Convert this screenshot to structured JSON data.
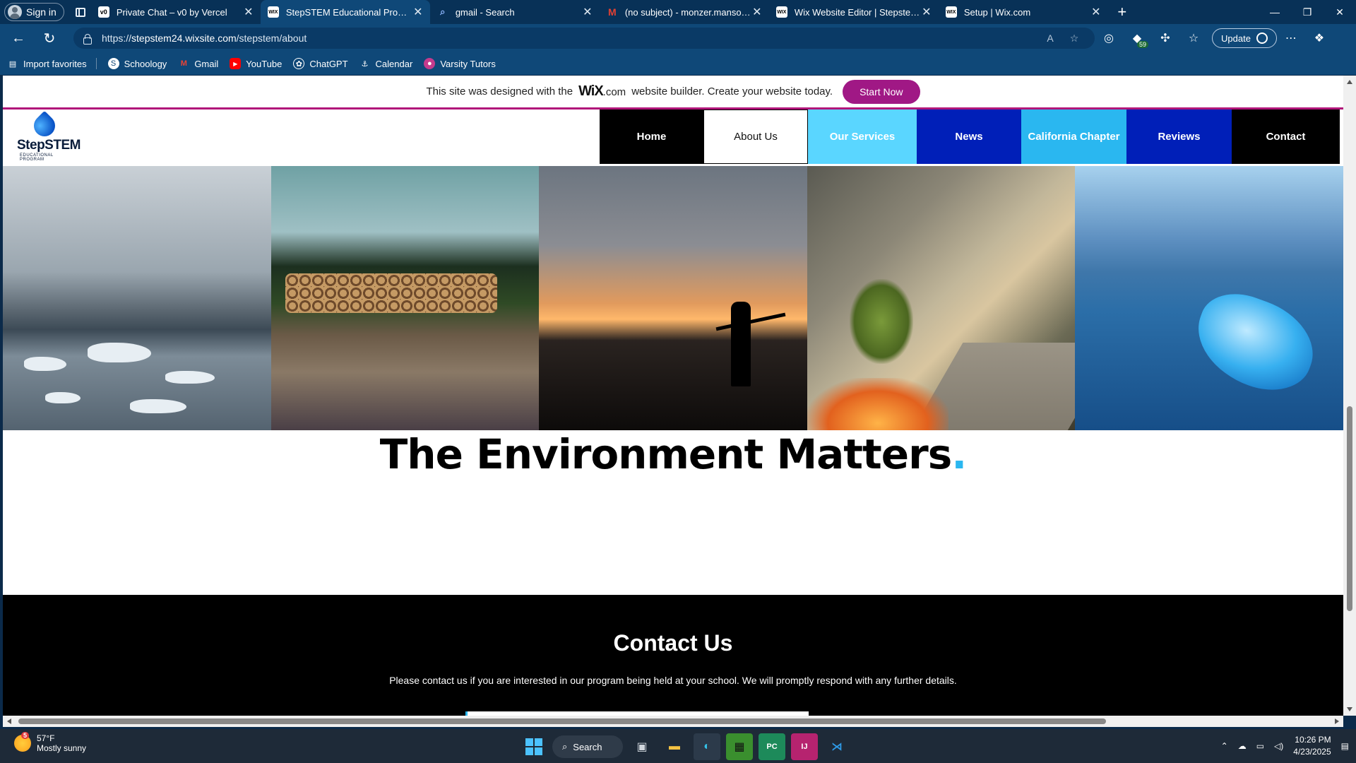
{
  "browser": {
    "signin_label": "Sign in",
    "tabs": [
      {
        "title": "Private Chat – v0 by Vercel",
        "favicon": "v0"
      },
      {
        "title": "StepSTEM Educational Program",
        "favicon": "WIX",
        "active": true
      },
      {
        "title": "gmail - Search",
        "favicon": "search"
      },
      {
        "title": "(no subject) - monzer.mansour@",
        "favicon": "M"
      },
      {
        "title": "Wix Website Editor | Stepstem Ed",
        "favicon": "WIX"
      },
      {
        "title": "Setup | Wix.com",
        "favicon": "WIX"
      }
    ],
    "url_prefix": "https://",
    "url_host": "stepstem24.wixsite.com",
    "url_path": "/stepstem/about",
    "extension_badge": "59",
    "update_label": "Update",
    "favorites": [
      {
        "label": "Import favorites",
        "icon": "import-icon"
      },
      {
        "label": "Schoology",
        "icon": "schoology-icon"
      },
      {
        "label": "Gmail",
        "icon": "gmail-icon"
      },
      {
        "label": "YouTube",
        "icon": "youtube-icon"
      },
      {
        "label": "ChatGPT",
        "icon": "chatgpt-icon"
      },
      {
        "label": "Calendar",
        "icon": "calendar-icon"
      },
      {
        "label": "Varsity Tutors",
        "icon": "varsity-icon"
      }
    ]
  },
  "wix_banner": {
    "text_before": "This site was designed with the",
    "logo": "WiX",
    "logo_suffix": ".com",
    "text_after": "website builder. Create your website today.",
    "cta": "Start Now"
  },
  "site": {
    "logo_text": "StepSTEM",
    "logo_sub": "EDUCATIONAL PROGRAM",
    "nav": [
      "Home",
      "About Us",
      "Our Services",
      "News",
      "California Chapter",
      "Reviews",
      "Contact"
    ],
    "active_nav": "About Us",
    "headline": "The Environment Matters",
    "headline_dot": ".",
    "contact_title": "Contact Us",
    "contact_text": "Please contact us if you are interested in our program being held at your school. We will promptly respond with any further details."
  },
  "taskbar": {
    "weather_temp": "57°F",
    "weather_desc": "Mostly sunny",
    "weather_badge": "5",
    "search_label": "Search",
    "time": "10:26 PM",
    "date": "4/23/2025"
  }
}
